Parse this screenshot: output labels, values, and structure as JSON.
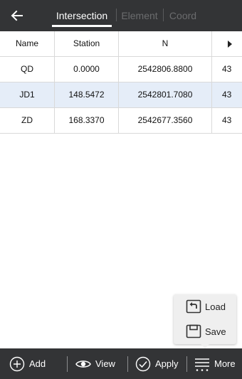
{
  "header": {
    "back_icon": "arrow-left-icon",
    "tabs": [
      {
        "label": "Intersection",
        "active": true
      },
      {
        "label": "Element",
        "active": false
      },
      {
        "label": "Coord",
        "active": false
      }
    ]
  },
  "table": {
    "columns": [
      "Name",
      "Station",
      "N",
      ""
    ],
    "rows": [
      {
        "name": "QD",
        "station": "0.0000",
        "n": "2542806.8800",
        "e": "43",
        "selected": false
      },
      {
        "name": "JD1",
        "station": "148.5472",
        "n": "2542801.7080",
        "e": "43",
        "selected": true
      },
      {
        "name": "ZD",
        "station": "168.3370",
        "n": "2542677.3560",
        "e": "43",
        "selected": false
      }
    ]
  },
  "popup_menu": {
    "items": [
      {
        "label": "Load",
        "icon": "load-icon"
      },
      {
        "label": "Save",
        "icon": "save-icon"
      }
    ]
  },
  "bottom_bar": {
    "buttons": [
      {
        "label": "Add",
        "icon": "plus-circle-icon"
      },
      {
        "label": "View",
        "icon": "eye-icon"
      },
      {
        "label": "Apply",
        "icon": "check-circle-icon"
      },
      {
        "label": "More",
        "icon": "more-icon"
      }
    ]
  },
  "colors": {
    "bar_background": "#333436",
    "selected_row": "#e5edf8",
    "inactive_tab": "#6b6c6e"
  }
}
